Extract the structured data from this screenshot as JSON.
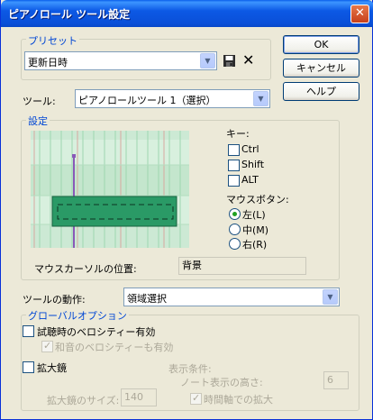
{
  "window": {
    "title": "ピアノロール ツール設定",
    "close_symbol": "✕"
  },
  "preset": {
    "group_label": "プリセット",
    "selected": "更新日時",
    "save_icon": "save-icon",
    "delete_symbol": "✕"
  },
  "buttons": {
    "ok": "OK",
    "cancel": "キャンセル",
    "help": "ヘルプ"
  },
  "tool": {
    "label": "ツール:",
    "selected": "ピアノロールツール 1（選択）"
  },
  "settings": {
    "group_label": "設定",
    "keys_label": "キー:",
    "ctrl": "Ctrl",
    "shift": "Shift",
    "alt": "ALT",
    "mouse_button_label": "マウスボタン:",
    "left": "左(L)",
    "middle": "中(M)",
    "right": "右(R)",
    "selected_mouse_button": "left",
    "cursor_pos_label": "マウスカーソルの位置:",
    "cursor_pos_value": "背景"
  },
  "action": {
    "label": "ツールの動作:",
    "selected": "領域選択"
  },
  "global": {
    "group_label": "グローバルオプション",
    "audition_velocity": "試聴時のベロシティー有効",
    "chord_velocity": "和音のベロシティーも有効",
    "magnifier": "拡大鏡",
    "display_condition": "表示条件:",
    "note_height_label": "ノート表示の高さ:",
    "note_height_value": "6",
    "magnifier_size_label": "拡大鏡のサイズ:",
    "magnifier_size_value": "140",
    "time_axis_zoom": "時間軸での拡大"
  },
  "colors": {
    "title_bar": "#0C59E5",
    "group_label": "#0046D5",
    "note_fill": "#2A9A66",
    "radio_dot": "#21A121"
  }
}
